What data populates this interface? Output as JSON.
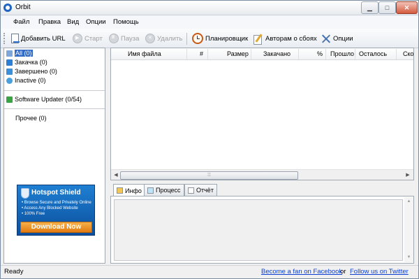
{
  "window": {
    "title": "Orbit"
  },
  "menu": [
    "Файл",
    "Правка",
    "Вид",
    "Опции",
    "Помощь"
  ],
  "toolbar": {
    "add_url": "Добавить URL",
    "start": "Старт",
    "pause": "Пауза",
    "delete": "Удалить",
    "scheduler": "Планировщик",
    "report": "Авторам о сбоях",
    "options": "Опции"
  },
  "categories": {
    "all": "All (0)",
    "downloading": "Закачка (0)",
    "completed": "Завершено (0)",
    "inactive": "Inactive (0)",
    "software_updater": "Software Updater (0/54)",
    "other": "Прочее (0)"
  },
  "ad": {
    "brand": "Hotspot Shield",
    "lines": [
      "• Browse Secure and Privately Online",
      "• Access Any Blocked Website",
      "• 100% Free"
    ],
    "button": "Download Now"
  },
  "list": {
    "columns": [
      "Имя файла",
      "#",
      "Размер",
      "Закачано",
      "%",
      "Прошло",
      "Осталось",
      "Скор"
    ]
  },
  "tabs": [
    "Инфо",
    "Процесс",
    "Отчёт"
  ],
  "status": {
    "text": "Ready",
    "facebook_link": "Become a fan on Facebook",
    "or": "or",
    "twitter_link": "Follow us on Twitter"
  },
  "colors": {
    "selection": "#3169c6",
    "link": "#0b3fd1",
    "ad_button": "#e07b11"
  }
}
